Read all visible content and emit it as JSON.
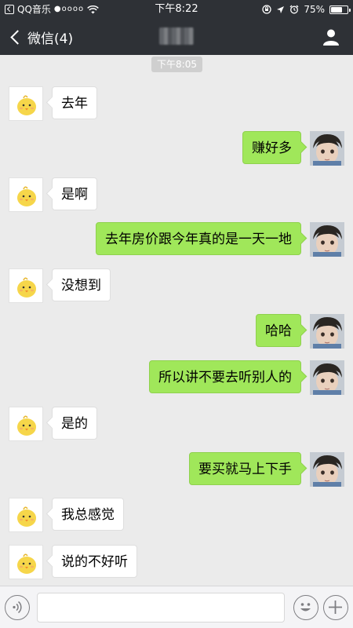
{
  "status_bar": {
    "app_name": "QQ音乐",
    "signal": "●oooo",
    "time": "下午8:22",
    "battery": "75%",
    "battery_level": 0.75
  },
  "nav": {
    "back_label": "微信(4)"
  },
  "chat": {
    "timestamp": "下午8:05",
    "messages": [
      {
        "side": "in",
        "text": "去年"
      },
      {
        "side": "out",
        "text": "赚好多"
      },
      {
        "side": "in",
        "text": "是啊"
      },
      {
        "side": "out",
        "text": "去年房价跟今年真的是一天一地"
      },
      {
        "side": "in",
        "text": "没想到"
      },
      {
        "side": "out",
        "text": "哈哈"
      },
      {
        "side": "out",
        "text": "所以讲不要去听别人的"
      },
      {
        "side": "in",
        "text": "是的"
      },
      {
        "side": "out",
        "text": "要买就马上下手"
      },
      {
        "side": "in",
        "text": "我总感觉"
      },
      {
        "side": "in",
        "text": "说的不好听"
      }
    ]
  },
  "input_bar": {
    "icons": [
      "voice-icon",
      "emoji-icon",
      "plus-icon"
    ]
  },
  "colors": {
    "header_bg": "#2e3136",
    "chat_bg": "#ebebeb",
    "outgoing_bubble": "#a0e75a",
    "incoming_bubble": "#ffffff"
  }
}
